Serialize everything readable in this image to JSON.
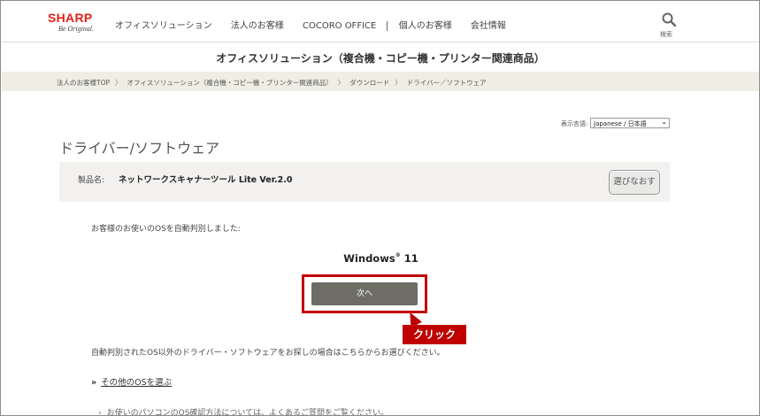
{
  "header": {
    "logo_main": "SHARP",
    "logo_sub": "Be Original.",
    "nav": [
      "オフィスソリューション",
      "法人のお客様",
      "COCORO OFFICE",
      "個人のお客様",
      "会社情報"
    ],
    "search_label": "検索",
    "search_icon": "search-icon"
  },
  "section_title": "オフィスソリューション（複合機・コピー機・プリンター関連商品）",
  "breadcrumb": [
    "法人のお客様TOP",
    "オフィスソリューション（複合機・コピー機・プリンター関連商品）",
    "ダウンロード",
    "ドライバー／ソフトウェア"
  ],
  "breadcrumb_arrow": "〉",
  "language": {
    "label": "表示言語:",
    "selected": "Japanese / 日本語"
  },
  "page_title": "ドライバー/ソフトウェア",
  "product": {
    "label": "製品名:",
    "name": "ネットワークスキャナーツール Lite Ver.2.0",
    "reselect_label": "選びなおす"
  },
  "auto_detect_message": "お客様のお使いのOSを自動判別しました:",
  "os": {
    "name": "Windows",
    "reg": "®",
    "version": "11"
  },
  "next_button_label": "次へ",
  "annotation": {
    "label": "クリック",
    "color": "#c00000"
  },
  "other_os_message": "自動判別されたOS以外のドライバー・ソフトウェアをお探しの場合はこちらからお選びください。",
  "other_os_link": {
    "prefix": "»",
    "label": "その他のOSを選ぶ"
  },
  "faq_note": "お使いのパソコンのOS確認方法については、よくあるご質問をご覧ください。",
  "colors": {
    "brand": "#e2231a",
    "breadcrumb_bg": "#efeee4",
    "button_bg": "#6e6d65"
  }
}
